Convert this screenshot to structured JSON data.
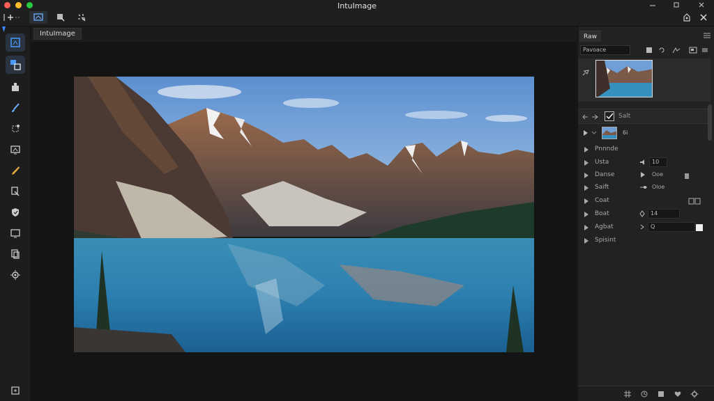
{
  "app": {
    "title": "IntuImage"
  },
  "tooltip": {
    "text": "IntuImage"
  },
  "titlebar": {
    "add_label": "+",
    "tools": [
      "add-tool",
      "crop-tool",
      "select-tool",
      "effects-tool"
    ]
  },
  "left_tools": [
    "crop",
    "transform",
    "stamp",
    "brush",
    "lasso",
    "frame",
    "pencil",
    "clone",
    "shield",
    "monitor",
    "copy",
    "settings",
    "export"
  ],
  "panel": {
    "tab_label": "Raw",
    "search_value": "Pavoace",
    "props_title": "Salt",
    "layer_badge": "6i",
    "properties": [
      {
        "label": "Pnnnde",
        "value": ""
      },
      {
        "label": "Usta",
        "value": "10"
      },
      {
        "label": "Danse",
        "value": "Ooe"
      },
      {
        "label": "Saift",
        "value": "Oloe"
      },
      {
        "label": "Coat",
        "value": ""
      },
      {
        "label": "Boat",
        "value": "14"
      },
      {
        "label": "Agbat",
        "value": "Q"
      },
      {
        "label": "Spisint",
        "value": ""
      }
    ]
  },
  "colors": {
    "accent": "#3d8bff",
    "panel_bg": "#222222",
    "canvas_bg": "#141414"
  }
}
